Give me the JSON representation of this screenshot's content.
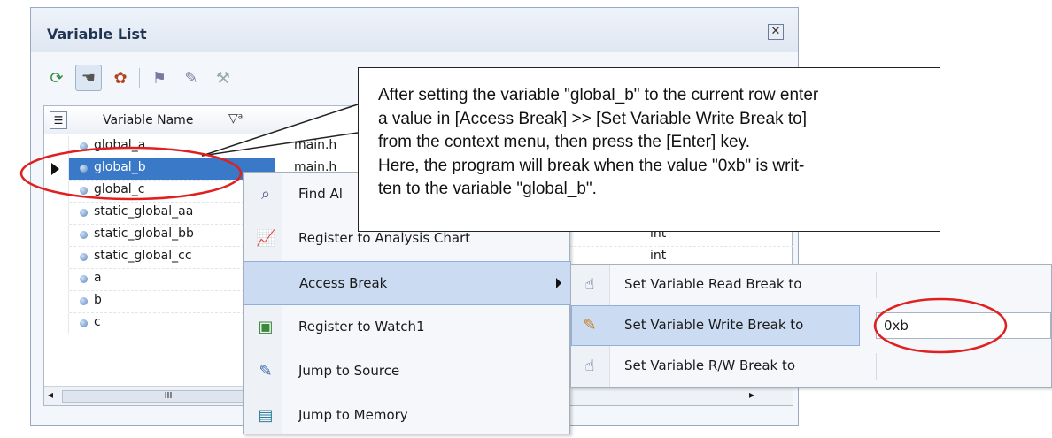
{
  "window": {
    "title": "Variable List",
    "close_icon": "close-icon"
  },
  "toolbar": {
    "icons": [
      "refresh-icon",
      "pointer-icon",
      "palette-icon",
      "break-icon",
      "write-break-icon",
      "rw-break-icon"
    ]
  },
  "table": {
    "header_name": "Variable Name",
    "header_filter": "▽ᵃ",
    "rows": [
      {
        "name": "global_a",
        "file": "main.h"
      },
      {
        "name": "global_b",
        "file": "main.h",
        "selected": true
      },
      {
        "name": "global_c",
        "file": ""
      },
      {
        "name": "static_global_aa",
        "file": ""
      },
      {
        "name": "static_global_bb",
        "file": ""
      },
      {
        "name": "static_global_cc",
        "file": ""
      },
      {
        "name": "a",
        "file": ""
      },
      {
        "name": "b",
        "file": ""
      },
      {
        "name": "c",
        "file": ""
      }
    ],
    "visible_types": [
      "int",
      "int"
    ],
    "scroll_thumb": "III"
  },
  "context_menu": {
    "items": [
      {
        "label": "Find All References",
        "icon": "find-references-icon"
      },
      {
        "label": "Register to Analysis Chart",
        "icon": "analysis-chart-icon"
      },
      {
        "label": "Access Break",
        "icon": "",
        "has_submenu": true,
        "highlighted": true
      },
      {
        "label": "Register to Watch1",
        "icon": "watch-icon"
      },
      {
        "label": "Jump to Source",
        "icon": "jump-source-icon"
      },
      {
        "label": "Jump to Memory",
        "icon": "jump-memory-icon"
      }
    ],
    "find_visible": "Find Al"
  },
  "submenu": {
    "items": [
      {
        "label": "Set Variable Read Break to",
        "icon": "read-break-icon",
        "value": ""
      },
      {
        "label": "Set Variable Write Break to",
        "icon": "write-break-icon",
        "value": "0xb",
        "highlighted": true
      },
      {
        "label": "Set Variable R/W Break to",
        "icon": "rw-break-icon",
        "value": ""
      }
    ]
  },
  "callout": {
    "lines": [
      "After setting the variable \"global_b\" to the current row enter",
      "a value in [Access Break] >> [Set Variable Write Break to]",
      "from the context menu, then press the [Enter] key.",
      "Here, the program will break when the value \"0xb\" is writ-",
      "ten to the variable \"global_b\"."
    ]
  },
  "colors": {
    "selection": "#3a78c8",
    "menu_highlight": "#cbdcf2",
    "annotation_red": "#e02020"
  }
}
